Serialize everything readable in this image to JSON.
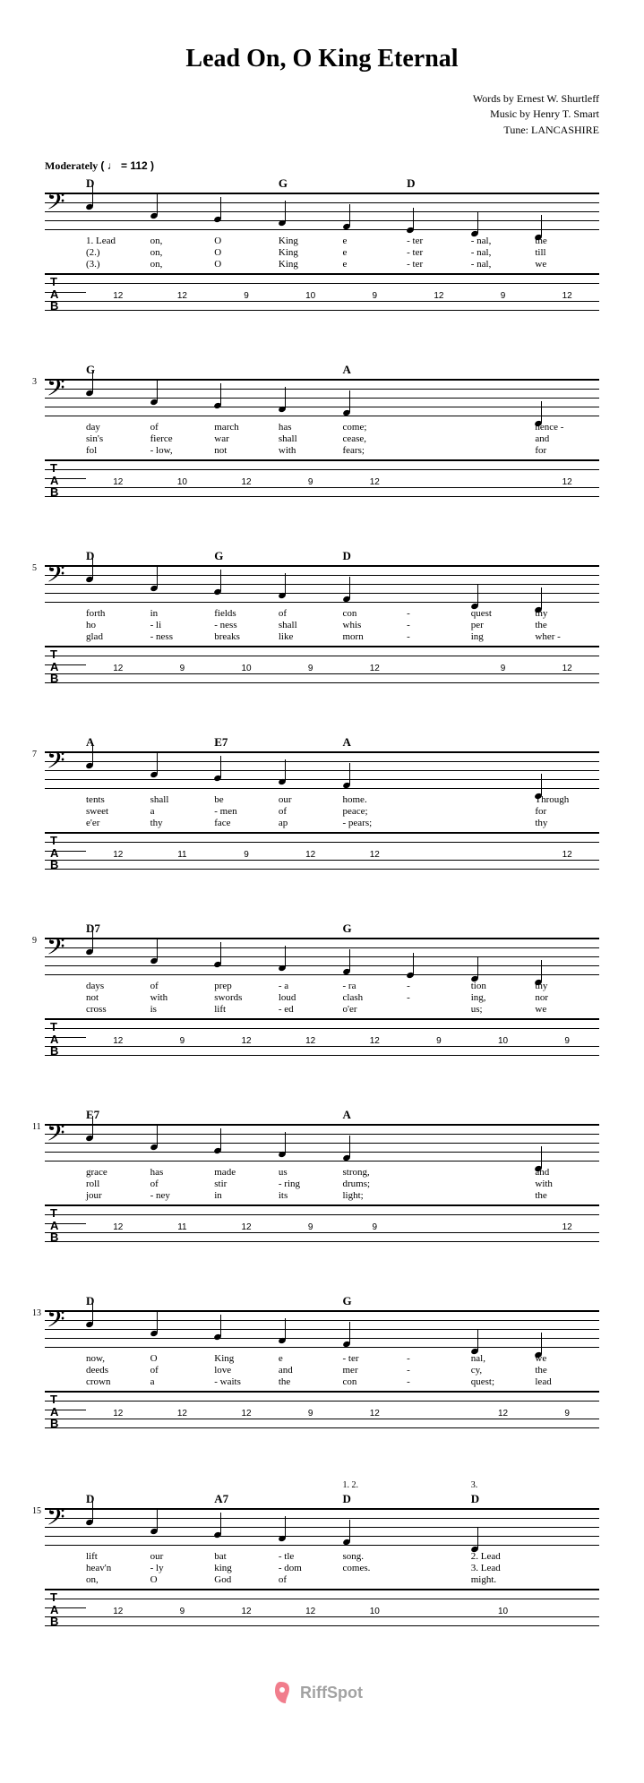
{
  "title": "Lead On, O King Eternal",
  "credits": {
    "words": "Words by Ernest W. Shurtleff",
    "music": "Music by Henry T. Smart",
    "tune": "Tune: LANCASHIRE"
  },
  "tempo": {
    "label": "Moderately",
    "marking": "( ♩ = 112 )"
  },
  "clef": "𝄢",
  "tab_label": [
    "T",
    "A",
    "B"
  ],
  "systems": [
    {
      "bar": "",
      "chords": [
        "D",
        "",
        "",
        "G",
        "",
        "D",
        "",
        ""
      ],
      "lyrics": [
        [
          "1. Lead",
          "on,",
          "O",
          "King",
          "e",
          "- ter",
          "- nal,",
          "the"
        ],
        [
          "(2.)",
          "on,",
          "O",
          "King",
          "e",
          "- ter",
          "- nal,",
          "till"
        ],
        [
          "(3.)",
          "on,",
          "O",
          "King",
          "e",
          "- ter",
          "- nal,",
          "we"
        ]
      ],
      "frets": [
        "12",
        "12",
        "9",
        "10",
        "9",
        "12",
        "9",
        "12"
      ]
    },
    {
      "bar": "3",
      "chords": [
        "G",
        "",
        "",
        "",
        "A",
        "",
        "",
        ""
      ],
      "lyrics": [
        [
          "day",
          "of",
          "march",
          "has",
          "come;",
          "",
          "",
          "hence -"
        ],
        [
          "sin's",
          "fierce",
          "war",
          "shall",
          "cease,",
          "",
          "",
          "and"
        ],
        [
          "fol",
          "- low,",
          "not",
          "with",
          "fears;",
          "",
          "",
          "for"
        ]
      ],
      "frets": [
        "12",
        "10",
        "12",
        "9",
        "12",
        "",
        "",
        "12"
      ]
    },
    {
      "bar": "5",
      "chords": [
        "D",
        "",
        "G",
        "",
        "D",
        "",
        "",
        ""
      ],
      "lyrics": [
        [
          "forth",
          "in",
          "fields",
          "of",
          "con",
          "-",
          "quest",
          "thy"
        ],
        [
          "ho",
          "- li",
          "- ness",
          "shall",
          "whis",
          "-",
          "per",
          "the"
        ],
        [
          "glad",
          "- ness",
          "breaks",
          "like",
          "morn",
          "-",
          "ing",
          "wher -"
        ]
      ],
      "frets": [
        "12",
        "9",
        "10",
        "9",
        "12",
        "",
        "9",
        "12"
      ]
    },
    {
      "bar": "7",
      "chords": [
        "A",
        "",
        "E7",
        "",
        "A",
        "",
        "",
        ""
      ],
      "lyrics": [
        [
          "tents",
          "shall",
          "be",
          "our",
          "home.",
          "",
          "",
          "Through"
        ],
        [
          "sweet",
          "a",
          "- men",
          "of",
          "peace;",
          "",
          "",
          "for"
        ],
        [
          "e'er",
          "thy",
          "face",
          "ap",
          "- pears;",
          "",
          "",
          "thy"
        ]
      ],
      "frets": [
        "12",
        "11",
        "9",
        "12",
        "12",
        "",
        "",
        "12"
      ]
    },
    {
      "bar": "9",
      "chords": [
        "D7",
        "",
        "",
        "",
        "G",
        "",
        "",
        ""
      ],
      "lyrics": [
        [
          "days",
          "of",
          "prep",
          "- a",
          "- ra",
          "-",
          "tion",
          "thy"
        ],
        [
          "not",
          "with",
          "swords",
          "loud",
          "clash",
          "-",
          "ing,",
          "nor"
        ],
        [
          "cross",
          "is",
          "lift",
          "- ed",
          "o'er",
          "",
          "us;",
          "we"
        ]
      ],
      "frets": [
        "12",
        "9",
        "12",
        "12",
        "12",
        "9",
        "10",
        "9"
      ]
    },
    {
      "bar": "11",
      "chords": [
        "E7",
        "",
        "",
        "",
        "A",
        "",
        "",
        ""
      ],
      "lyrics": [
        [
          "grace",
          "has",
          "made",
          "us",
          "strong,",
          "",
          "",
          "and"
        ],
        [
          "roll",
          "of",
          "stir",
          "- ring",
          "drums;",
          "",
          "",
          "with"
        ],
        [
          "jour",
          "- ney",
          "in",
          "its",
          "light;",
          "",
          "",
          "the"
        ]
      ],
      "frets": [
        "12",
        "11",
        "12",
        "9",
        "9",
        "",
        "",
        "12"
      ]
    },
    {
      "bar": "13",
      "chords": [
        "D",
        "",
        "",
        "",
        "G",
        "",
        "",
        ""
      ],
      "lyrics": [
        [
          "now,",
          "O",
          "King",
          "e",
          "- ter",
          "-",
          "nal,",
          "we"
        ],
        [
          "deeds",
          "of",
          "love",
          "and",
          "mer",
          "-",
          "cy,",
          "the"
        ],
        [
          "crown",
          "a",
          "- waits",
          "the",
          "con",
          "-",
          "quest;",
          "lead"
        ]
      ],
      "frets": [
        "12",
        "12",
        "12",
        "9",
        "12",
        "",
        "12",
        "9"
      ]
    },
    {
      "bar": "15",
      "chords": [
        "D",
        "",
        "A7",
        "",
        "D",
        "",
        "D",
        ""
      ],
      "endings": [
        "",
        "",
        "",
        "",
        "1. 2.",
        "",
        "3.",
        ""
      ],
      "lyrics": [
        [
          "lift",
          "our",
          "bat",
          "- tle",
          "song.",
          "",
          "2. Lead",
          ""
        ],
        [
          "heav'n",
          "- ly",
          "king",
          "- dom",
          "comes.",
          "",
          "3. Lead",
          ""
        ],
        [
          "on,",
          "O",
          "God",
          "of",
          "",
          "",
          "might.",
          ""
        ]
      ],
      "frets": [
        "12",
        "9",
        "12",
        "12",
        "10",
        "",
        "10",
        ""
      ]
    }
  ],
  "watermark": "RiffSpot"
}
